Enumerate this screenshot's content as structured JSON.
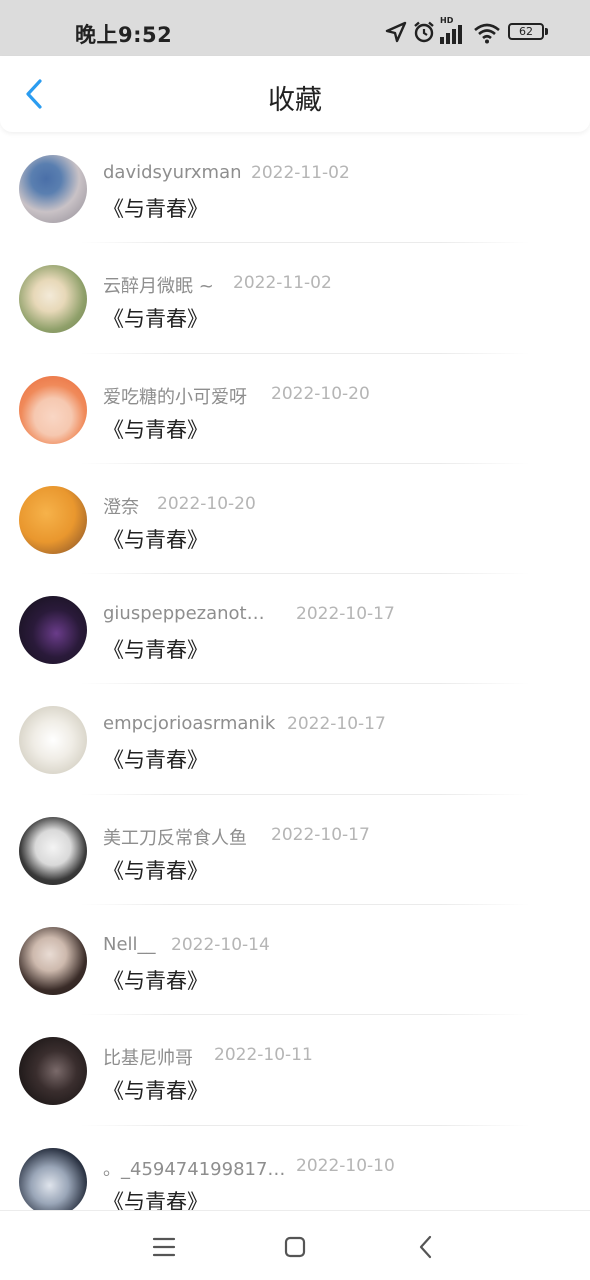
{
  "status_bar": {
    "time": "晚上9:52",
    "battery": "62",
    "network_badge": "HD",
    "icons": [
      "location-icon",
      "alarm-icon",
      "signal-icon",
      "wifi-icon",
      "battery-icon"
    ]
  },
  "header": {
    "title": "收藏",
    "back_icon": "chevron-left-icon",
    "accent_color": "#2b9cf0"
  },
  "favorites": [
    {
      "user": "davidsyurxman",
      "date": "2022-11-02",
      "title": "《与青春》"
    },
    {
      "user": "云醉月微眠 ~",
      "date": "2022-11-02",
      "title": "《与青春》"
    },
    {
      "user": "爱吃糖的小可爱呀",
      "date": "2022-10-20",
      "title": "《与青春》"
    },
    {
      "user": "澄奈",
      "date": "2022-10-20",
      "title": "《与青春》"
    },
    {
      "user": "giuspeppezanot…",
      "date": "2022-10-17",
      "title": "《与青春》"
    },
    {
      "user": "empcjorioasrmanik",
      "date": "2022-10-17",
      "title": "《与青春》"
    },
    {
      "user": "美工刀反常食人鱼",
      "date": "2022-10-17",
      "title": "《与青春》"
    },
    {
      "user": "Nell__",
      "date": "2022-10-14",
      "title": "《与青春》"
    },
    {
      "user": "比基尼帅哥",
      "date": "2022-10-11",
      "title": "《与青春》"
    },
    {
      "user": "。_459474199817…",
      "date": "2022-10-10",
      "title": "《与青春》"
    }
  ],
  "nav_bar": {
    "icons": [
      "menu-icon",
      "home-square-icon",
      "back-triangle-icon"
    ]
  }
}
